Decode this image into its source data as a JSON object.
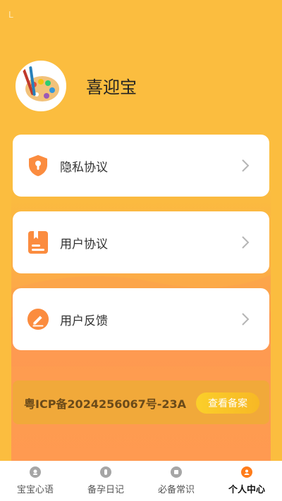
{
  "status": {
    "mark": "L"
  },
  "profile": {
    "name": "喜迎宝"
  },
  "menu": [
    {
      "label": "隐私协议",
      "icon": "shield-keyhole-icon"
    },
    {
      "label": "用户协议",
      "icon": "document-icon"
    },
    {
      "label": "用户反馈",
      "icon": "edit-pen-icon"
    }
  ],
  "icp": {
    "text": "粤ICP备2024256067号-23A",
    "button": "查看备案"
  },
  "tabs": [
    {
      "label": "宝宝心语",
      "icon": "face-icon"
    },
    {
      "label": "备孕日记",
      "icon": "bottle-icon"
    },
    {
      "label": "必备常识",
      "icon": "book-icon"
    },
    {
      "label": "个人中心",
      "icon": "person-icon",
      "active": true
    }
  ],
  "colors": {
    "accent": "#fbbd3f",
    "icon_orange": "#fb8c3f",
    "tab_active": "#ff7c1a"
  }
}
